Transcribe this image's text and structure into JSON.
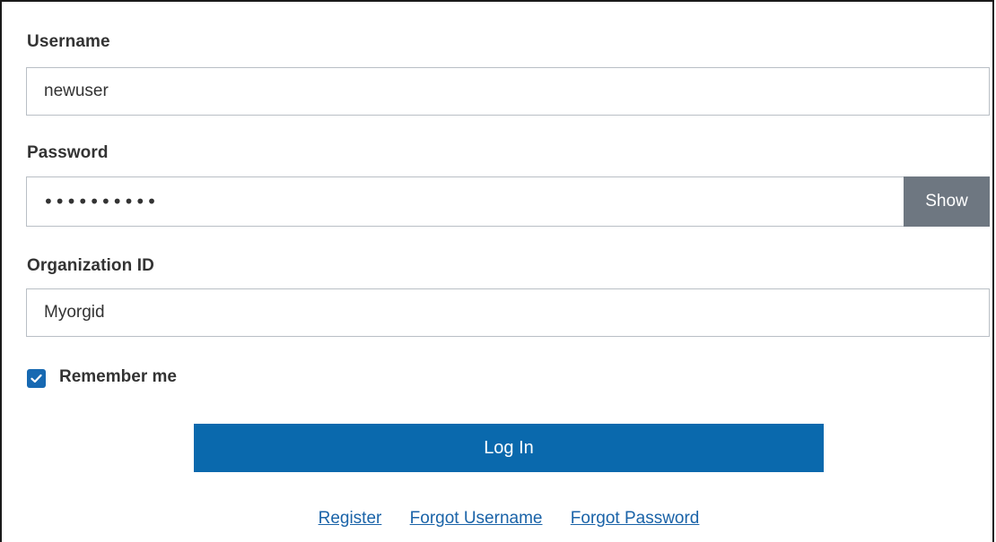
{
  "form": {
    "username": {
      "label": "Username",
      "value": "newuser"
    },
    "password": {
      "label": "Password",
      "value": "••••••••••",
      "show_label": "Show"
    },
    "organization": {
      "label": "Organization ID",
      "value": "Myorgid"
    },
    "remember": {
      "label": "Remember me",
      "checked": true
    },
    "login_label": "Log In"
  },
  "links": {
    "register": "Register",
    "forgot_username": "Forgot Username",
    "forgot_password": "Forgot Password"
  },
  "colors": {
    "primary": "#0a69ad",
    "show_button": "#6e7781",
    "link": "#1a63a8",
    "checkbox": "#1769b2"
  },
  "icons": {
    "checkbox": "checkmark-icon"
  }
}
